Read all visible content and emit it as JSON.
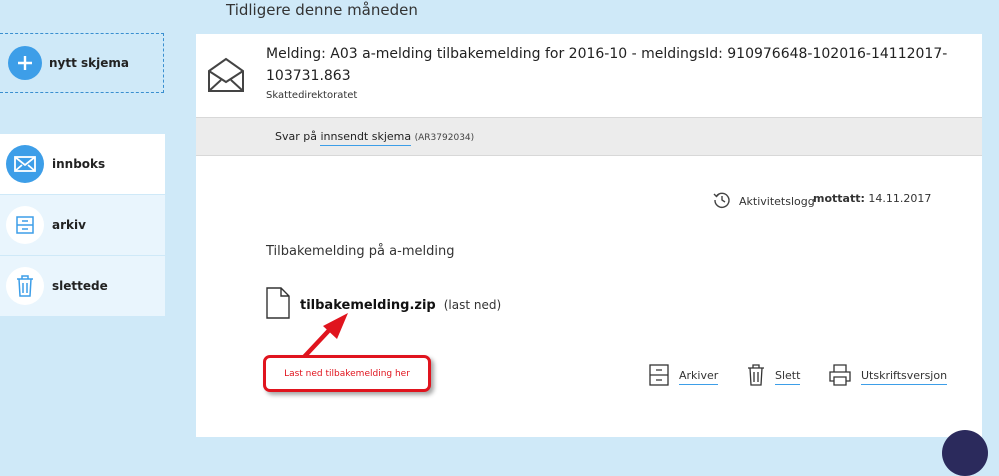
{
  "sidebar": {
    "new_form_label": "nytt skjema",
    "items": [
      {
        "label": "innboks",
        "icon": "envelope-icon",
        "active": true
      },
      {
        "label": "arkiv",
        "icon": "archive-icon",
        "active": false
      },
      {
        "label": "slettede",
        "icon": "trash-icon",
        "active": false
      }
    ]
  },
  "main": {
    "section_heading": "Tidligere denne måneden",
    "message": {
      "title": "Melding: A03 a-melding tilbakemelding for 2016-10 - meldingsId: 910976648-102016-14112017-103731.863",
      "sender": "Skattedirektoratet",
      "reply": {
        "prefix": "Svar på",
        "link_label": "innsendt skjema",
        "reference": "(AR3792034)"
      },
      "activity_log_label": "Aktivitetslogg",
      "received_label": "mottatt:",
      "received_date": "14.11.2017",
      "attachment_heading": "Tilbakemelding på a-melding",
      "file_name": "tilbakemelding.zip",
      "download_label": "(last ned)",
      "actions": [
        {
          "label": "Arkiver",
          "icon": "archive-icon"
        },
        {
          "label": "Slett",
          "icon": "trash-icon"
        },
        {
          "label": "Utskriftsversjon",
          "icon": "printer-icon"
        }
      ]
    }
  },
  "annotation": {
    "callout_text": "Last ned tilbakemelding her",
    "color": "#e0141e"
  },
  "colors": {
    "accent": "#3d9ee8",
    "background": "#cfe9f8"
  }
}
